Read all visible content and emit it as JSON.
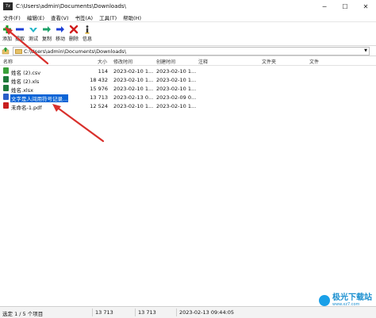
{
  "window": {
    "title": "C:\\Users\\admin\\Documents\\Downloads\\",
    "app_icon_text": "7z",
    "minimize": "─",
    "maximize": "☐",
    "close": "✕"
  },
  "menu": [
    "文件(F)",
    "编辑(E)",
    "查看(V)",
    "书签(A)",
    "工具(T)",
    "帮助(H)"
  ],
  "toolbar": {
    "add": "添加",
    "extract": "提取",
    "test": "测试",
    "copy": "复制",
    "move": "移动",
    "delete": "删除",
    "info": "信息"
  },
  "toolbar_colors": {
    "add": "#1a9d2a",
    "extract": "#1c3fd6",
    "test": "#21b5c7",
    "copy": "#1fa26a",
    "move": "#1c3fd6",
    "delete": "#d01c1c",
    "info": "#333333"
  },
  "address": {
    "path": "C:\\Users\\admin\\Documents\\Downloads\\"
  },
  "columns": {
    "name": "名称",
    "size": "大小",
    "modified": "修改时间",
    "created": "创建时间",
    "comment": "注释",
    "folders": "文件夹",
    "files": "文件"
  },
  "files": [
    {
      "name": "姓名 (2).csv",
      "size": "114",
      "modified": "2023-02-10 1...",
      "created": "2023-02-10 1...",
      "icon": "csv-file-icon",
      "color": "#3aa13a"
    },
    {
      "name": "姓名 (2).xls",
      "size": "18 432",
      "modified": "2023-02-10 1...",
      "created": "2023-02-10 1...",
      "icon": "excel-file-icon",
      "color": "#1e7a3a"
    },
    {
      "name": "姓名.xlsx",
      "size": "15 976",
      "modified": "2023-02-10 1...",
      "created": "2023-02-10 1...",
      "icon": "excel-file-icon",
      "color": "#1e7a3a"
    },
    {
      "name": "文字是人间用符号记录...",
      "size": "13 713",
      "modified": "2023-02-13 0...",
      "created": "2023-02-09 0...",
      "icon": "word-file-icon",
      "color": "#2a5ec7"
    },
    {
      "name": "未命名-1.pdf",
      "size": "12 524",
      "modified": "2023-02-10 1...",
      "created": "2023-02-10 1...",
      "icon": "pdf-file-icon",
      "color": "#c81e1e"
    }
  ],
  "status": {
    "selection": "选定 1 / 5 个项目",
    "size": "13 713",
    "packed": "13 713",
    "datetime": "2023-02-13 09:44:05"
  },
  "watermark": {
    "main": "极光下载站",
    "sub": "www.xz7.com"
  },
  "annotation_color": "#d9302c"
}
